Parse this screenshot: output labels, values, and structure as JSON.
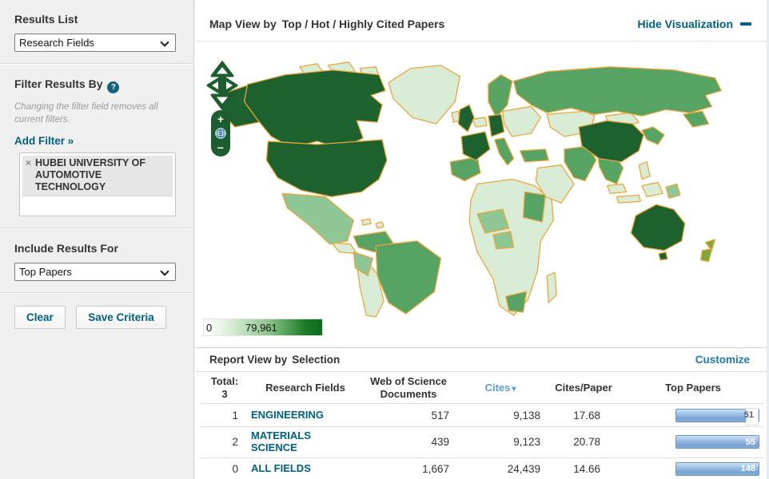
{
  "icons": {
    "help": "?",
    "remove_chip": "×",
    "sort_desc": "▾",
    "zoom_in": "+",
    "zoom_out": "−"
  },
  "colors": {
    "teal_link": "#00607f",
    "blue_link": "#2079b4",
    "map_dark_green": "#1d612e",
    "map_medium_green": "#57a363",
    "map_light_green": "#8ec695",
    "map_pale_green": "#d9edd6",
    "map_border_orange": "#e9a63a",
    "legend_gradient_start": "#ffffff",
    "legend_gradient_end": "#0b6c1d",
    "bar_blue": "#7aa3d4"
  },
  "sidebar": {
    "results_list_label": "Results List",
    "results_list_value": "Research Fields",
    "filter_heading": "Filter Results By",
    "filter_note": "Changing the filter field removes all current filters.",
    "add_filter_label": "Add Filter »",
    "chip_label": "HUBEI UNIVERSITY OF AUTOMOTIVE TECHNOLOGY",
    "include_label": "Include Results For",
    "include_value": "Top Papers",
    "clear_button": "Clear",
    "save_button": "Save Criteria"
  },
  "map_section": {
    "title_prefix": "Map View by",
    "title_value": "Top / Hot / Highly Cited Papers",
    "hide_link": "Hide Visualization",
    "legend_min": "0",
    "legend_max": "79,961"
  },
  "report_section": {
    "title_prefix": "Report View by",
    "title_value": "Selection",
    "customize_link": "Customize",
    "table": {
      "total_label": "Total:",
      "total_value": "3",
      "col_field": "Research Fields",
      "col_docs": "Web of Science Documents",
      "col_cites": "Cites",
      "col_cpp": "Cites/Paper",
      "col_top": "Top Papers",
      "rows": [
        {
          "rank": "1",
          "field": "ENGINEERING",
          "docs": "517",
          "cites": "9,138",
          "cpp": "17.68",
          "top": "51"
        },
        {
          "rank": "2",
          "field": "MATERIALS SCIENCE",
          "docs": "439",
          "cites": "9,123",
          "cpp": "20.78",
          "top": "55"
        },
        {
          "rank": "0",
          "field": "ALL FIELDS",
          "docs": "1,667",
          "cites": "24,439",
          "cpp": "14.66",
          "top": "148"
        }
      ]
    }
  }
}
